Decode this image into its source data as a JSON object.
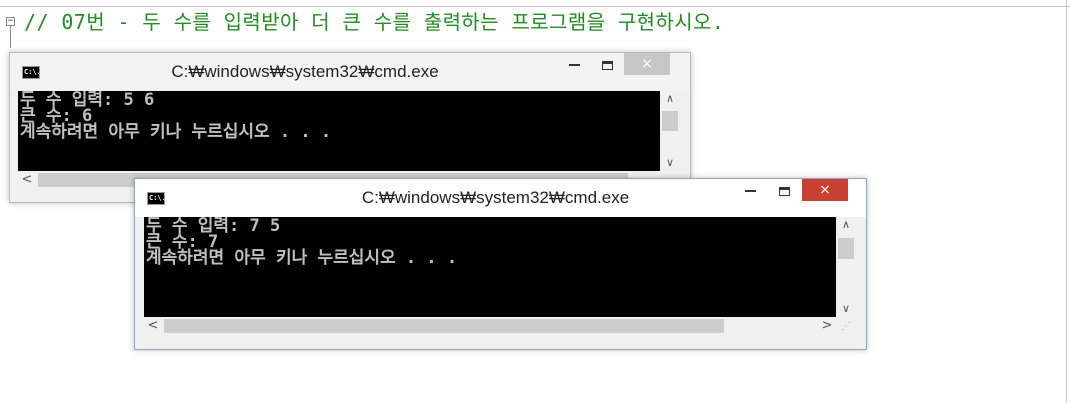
{
  "editor": {
    "fold_symbol": "−",
    "comment": "// 07번 - 두 수를 입력받아 더 큰 수를 출력하는 프로그램을 구현하시오."
  },
  "windows": [
    {
      "title": "C:₩windows₩system32₩cmd.exe",
      "icon": "cmd-icon",
      "icon_text": "C:\\.",
      "lines": [
        "두 수 입력: 5 6",
        "큰 수: 6",
        "계속하려면 아무 키나 누르십시오 . . ."
      ],
      "close_symbol": "×",
      "active": false
    },
    {
      "title": "C:₩windows₩system32₩cmd.exe",
      "icon": "cmd-icon",
      "icon_text": "C:\\.",
      "lines": [
        "두 수 입력: 7 5",
        "큰 수: 7",
        "계속하려면 아무 키나 누르십시오 . . ."
      ],
      "close_symbol": "×",
      "active": true
    }
  ],
  "colors": {
    "comment": "#228b22",
    "console_bg": "#000000",
    "console_text": "#c0c0c0",
    "close_active": "#c84031",
    "close_inactive": "#c7c7c7"
  },
  "scroll_arrows": {
    "up": "∧",
    "down": "∨",
    "left": "<",
    "right": ">",
    "grip": "⋰"
  }
}
